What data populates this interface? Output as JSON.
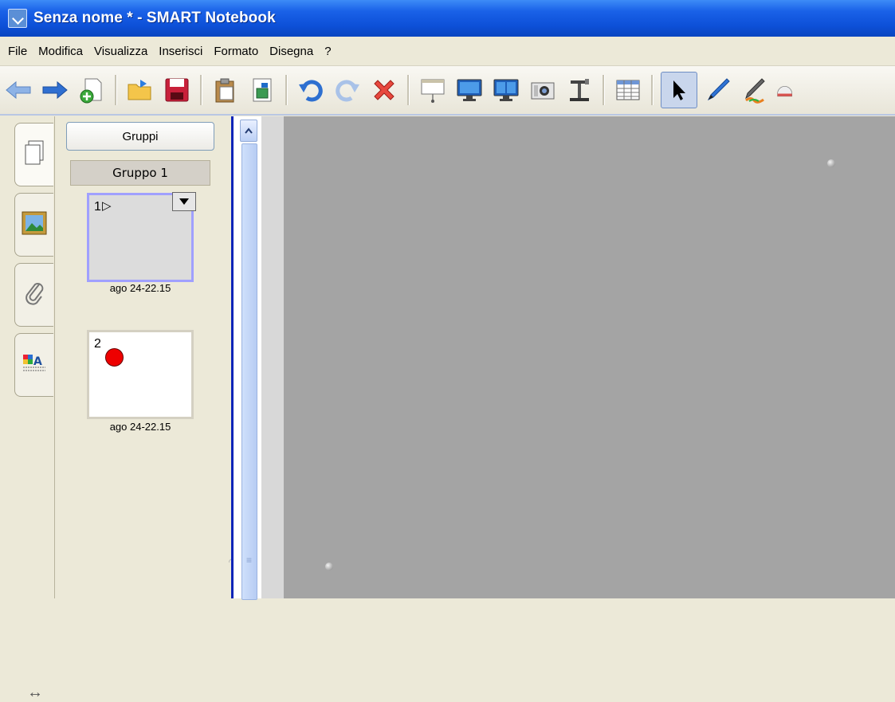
{
  "window": {
    "title": "Senza nome * - SMART Notebook"
  },
  "menu": [
    "File",
    "Modifica",
    "Visualizza",
    "Inserisci",
    "Formato",
    "Disegna",
    "?"
  ],
  "toolbar": {
    "buttons": [
      "back-arrow-icon",
      "forward-arrow-icon",
      "new-page-icon",
      "open-folder-icon",
      "save-icon",
      "paste-icon",
      "screen-capture-icon",
      "undo-icon",
      "redo-icon",
      "delete-icon",
      "screen-shade-icon",
      "full-screen-icon",
      "dual-page-icon",
      "camera-icon",
      "document-camera-icon",
      "table-icon",
      "select-arrow-icon",
      "pen-icon",
      "creative-pen-icon",
      "eraser-icon"
    ]
  },
  "left_tabs": [
    "page-sorter-icon",
    "gallery-icon",
    "attachments-icon",
    "properties-icon"
  ],
  "sorter": {
    "groups_button": "Gruppi",
    "group_label": "Gruppo 1",
    "pages": [
      {
        "number": "1",
        "date": "ago 24-22.15"
      },
      {
        "number": "2",
        "date": "ago 24-22.15"
      }
    ]
  },
  "colors": {
    "titlebar": "#0d50d8",
    "canvas": "#a4a4a4",
    "selection": "#a0a0ff",
    "red_dot": "#e00000"
  }
}
